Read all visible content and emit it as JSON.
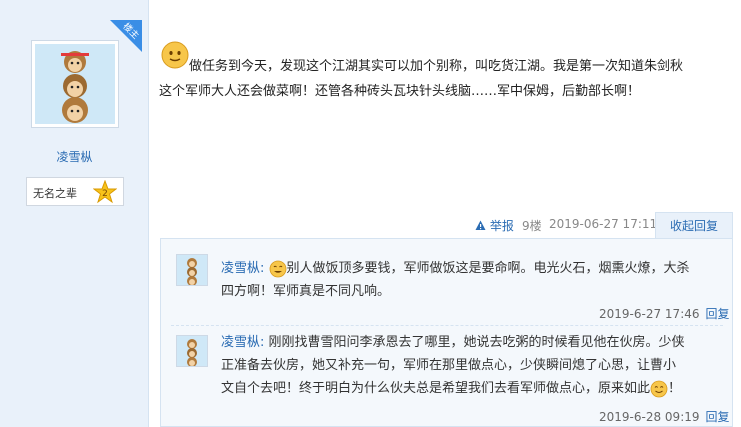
{
  "author": {
    "name": "凌雪枞",
    "rank_title": "无名之辈",
    "rank_level": "2",
    "badge_label": "楼主"
  },
  "post": {
    "line1": "做任务到今天，发现这个江湖其实可以加个别称，叫吃货江湖。我是第一次知道朱剑秋",
    "line2": "这个军师大人还会做菜啊！还管各种砖头瓦块针头线脑……军中保姆，后勤部长啊！"
  },
  "meta": {
    "report_label": "举报",
    "floor": "9楼",
    "timestamp": "2019-06-27 17:11",
    "collapse_label": "收起回复"
  },
  "replies": [
    {
      "author": "凌雪枞:",
      "text_line1": "别人做饭顶多要钱，军师做饭这是要命啊。电光火石，烟熏火燎，大杀",
      "text_line2": "四方啊！军师真是不同凡响。",
      "timestamp": "2019-6-27 17:46",
      "reply_label": "回复"
    },
    {
      "author": "凌雪枞:",
      "text_line1": "刚刚找曹雪阳问李承恩去了哪里，她说去吃粥的时候看见他在伙房。少侠",
      "text_line2": "正准备去伙房，她又补充一句，军师在那里做点心，少侠瞬间熄了心思，让曹小",
      "text_line3": "文自个去吧！终于明白为什么伙夫总是希望我们去看军师做点心，原来如此",
      "text_end": "！",
      "timestamp": "2019-6-28 09:19",
      "reply_label": "回复"
    }
  ]
}
